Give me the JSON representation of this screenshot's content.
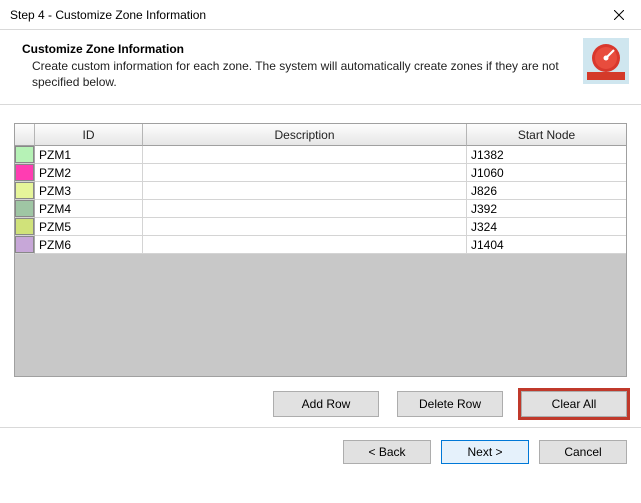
{
  "window": {
    "title": "Step 4 - Customize Zone Information"
  },
  "header": {
    "title": "Customize Zone Information",
    "description": "Create custom information for each zone.  The system will automatically create zones if they are not specified below."
  },
  "grid": {
    "columns": {
      "color": "",
      "id": "ID",
      "description": "Description",
      "start_node": "Start Node"
    },
    "rows": [
      {
        "color": "#b6f2b6",
        "id": "PZM1",
        "description": "",
        "start_node": "J1382"
      },
      {
        "color": "#ff3db2",
        "id": "PZM2",
        "description": "",
        "start_node": "J1060"
      },
      {
        "color": "#e6f59a",
        "id": "PZM3",
        "description": "",
        "start_node": "J826"
      },
      {
        "color": "#9fc6a4",
        "id": "PZM4",
        "description": "",
        "start_node": "J392"
      },
      {
        "color": "#d0e27a",
        "id": "PZM5",
        "description": "",
        "start_node": "J324"
      },
      {
        "color": "#c7a7d8",
        "id": "PZM6",
        "description": "",
        "start_node": "J1404"
      }
    ]
  },
  "actions": {
    "add_row": "Add Row",
    "delete_row": "Delete Row",
    "clear_all": "Clear All"
  },
  "nav": {
    "back": "< Back",
    "next": "Next >",
    "cancel": "Cancel"
  }
}
